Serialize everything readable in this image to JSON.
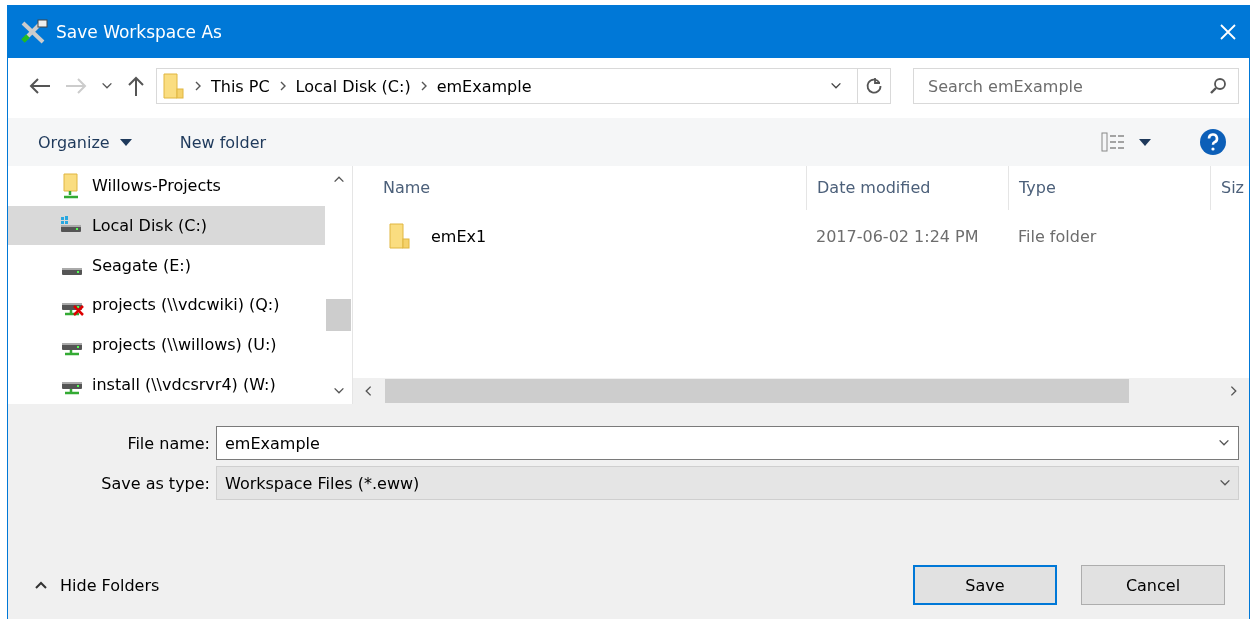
{
  "window": {
    "title": "Save Workspace As"
  },
  "address_bar": {
    "path": [
      "This PC",
      "Local Disk (C:)",
      "emExample"
    ]
  },
  "search": {
    "placeholder": "Search emExample"
  },
  "toolbar": {
    "organize": "Organize",
    "new_folder": "New folder"
  },
  "sidebar": {
    "items": [
      {
        "label": "Willows-Projects",
        "kind": "network-folder",
        "selected": false
      },
      {
        "label": "Local Disk (C:)",
        "kind": "system-disk",
        "selected": true
      },
      {
        "label": "Seagate (E:)",
        "kind": "drive",
        "selected": false
      },
      {
        "label": "projects (\\\\vdcwiki) (Q:)",
        "kind": "disconnected",
        "selected": false
      },
      {
        "label": "projects (\\\\willows) (U:)",
        "kind": "network-drive",
        "selected": false
      },
      {
        "label": "install (\\\\vdcsrvr4) (W:)",
        "kind": "network-drive",
        "selected": false
      }
    ]
  },
  "table": {
    "columns": [
      "Name",
      "Date modified",
      "Type",
      "Siz"
    ],
    "rows": [
      {
        "name": "emEx1",
        "date_modified": "2017-06-02 1:24 PM",
        "type": "File folder"
      }
    ]
  },
  "form": {
    "file_name_label": "File name:",
    "file_name": "emExample",
    "type_label": "Save as type:",
    "type_value": "Workspace Files (*.eww)"
  },
  "footer": {
    "hide_folders": "Hide Folders",
    "buttons": [
      "Save",
      "Cancel"
    ]
  }
}
